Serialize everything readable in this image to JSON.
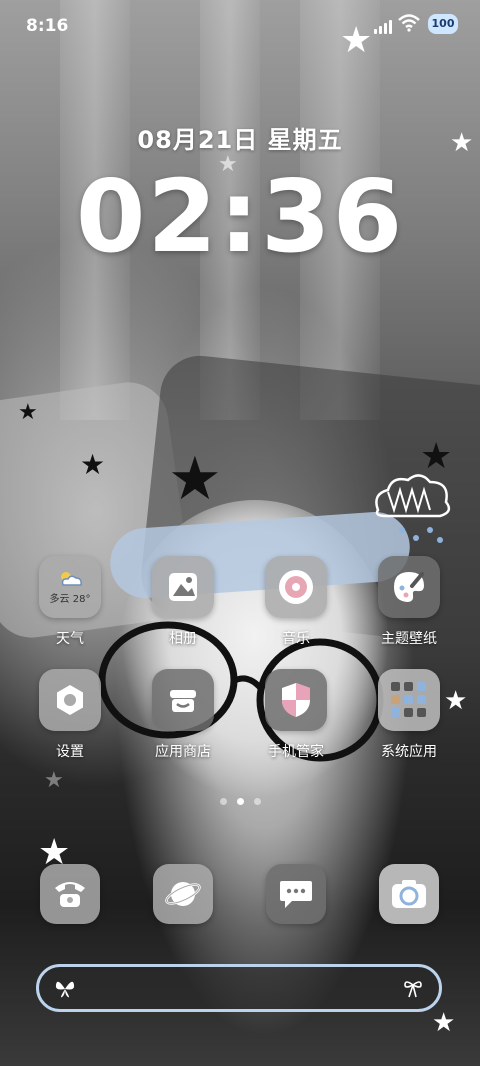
{
  "status_bar": {
    "time": "8:16",
    "battery": "100"
  },
  "lockscreen": {
    "date": "08月21日 星期五",
    "clock": "02:36"
  },
  "weather_widget": {
    "condition": "多云",
    "temp": "28°"
  },
  "apps": [
    {
      "label": "天气",
      "icon": "weather-icon"
    },
    {
      "label": "相册",
      "icon": "gallery-icon"
    },
    {
      "label": "音乐",
      "icon": "music-icon"
    },
    {
      "label": "主题壁纸",
      "icon": "palette-icon"
    },
    {
      "label": "设置",
      "icon": "settings-gear-icon"
    },
    {
      "label": "应用商店",
      "icon": "store-icon"
    },
    {
      "label": "手机管家",
      "icon": "shield-icon"
    },
    {
      "label": "系统应用",
      "icon": "folder-icon"
    }
  ],
  "dock": [
    {
      "icon": "phone-icon"
    },
    {
      "icon": "browser-planet-icon"
    },
    {
      "icon": "messages-icon"
    },
    {
      "icon": "camera-icon"
    }
  ],
  "page_indicator": {
    "total": 3,
    "active": 2
  },
  "colors": {
    "search_border": "#bcd3ee",
    "battery_bg": "#cfe6ff",
    "shield_pink": "#e9a3b8",
    "music_pink": "#e7a6b4"
  }
}
